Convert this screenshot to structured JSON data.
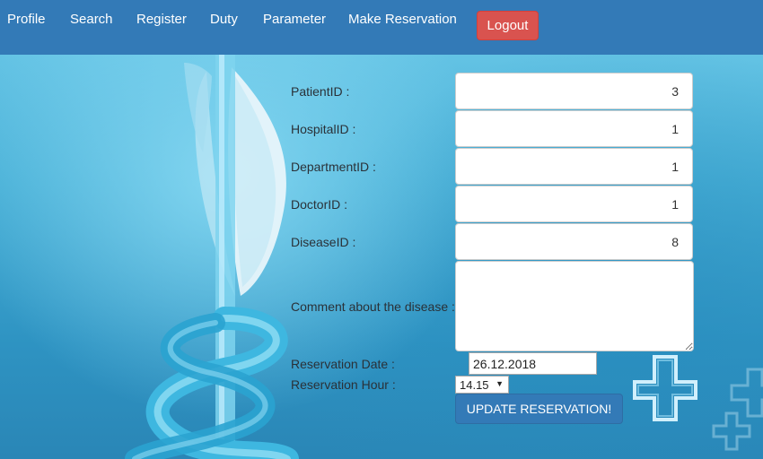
{
  "nav": {
    "items": [
      {
        "label": "Profile"
      },
      {
        "label": "Search"
      },
      {
        "label": "Register"
      },
      {
        "label": "Duty"
      },
      {
        "label": "Parameter"
      },
      {
        "label": "Make Reservation"
      }
    ],
    "logout_label": "Logout"
  },
  "form": {
    "patient_id": {
      "label": "PatientID :",
      "value": "3"
    },
    "hospital_id": {
      "label": "HospitalID :",
      "value": "1"
    },
    "department_id": {
      "label": "DepartmentID :",
      "value": "1"
    },
    "doctor_id": {
      "label": "DoctorID :",
      "value": "1"
    },
    "disease_id": {
      "label": "DiseaseID :",
      "value": "8"
    },
    "comment": {
      "label": "Comment about the disease :",
      "value": ""
    },
    "reservation_date": {
      "label": "Reservation Date :",
      "value": "26.12.2018"
    },
    "reservation_hour": {
      "label": "Reservation Hour :",
      "value": "14.15"
    },
    "submit_label": "UPDATE RESERVATION!"
  },
  "colors": {
    "navbar": "#337ab7",
    "logout": "#d9534f",
    "primary": "#337ab7"
  },
  "icons": {
    "medical_cross": "medical-cross-icon",
    "background_art": "caduceus-wing-illustration"
  }
}
